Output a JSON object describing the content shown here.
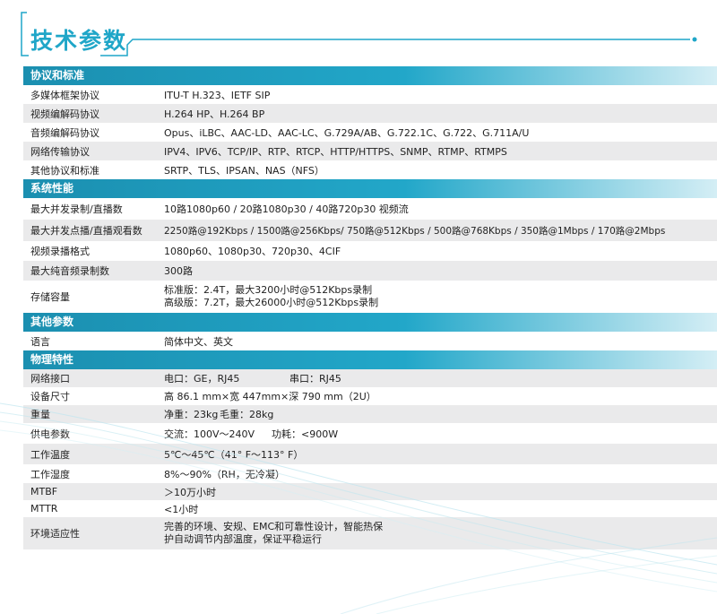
{
  "page": {
    "title": "技术参数"
  },
  "colors": {
    "accent": "#22a7c9",
    "row_alt": "#eaeaeb",
    "title": "#1fa6c8"
  },
  "sections": [
    {
      "title": "协议和标准",
      "rows": [
        {
          "label": "多媒体框架协议",
          "value": "ITU-T H.323、IETF SIP"
        },
        {
          "label": "视频编解码协议",
          "value": "H.264 HP、H.264 BP"
        },
        {
          "label": "音频编解码协议",
          "value": "Opus、iLBC、AAC-LD、AAC-LC、G.729A/AB、G.722.1C、G.722、G.711A/U"
        },
        {
          "label": "网络传输协议",
          "value": "IPV4、IPV6、TCP/IP、RTP、RTCP、HTTP/HTTPS、SNMP、RTMP、RTMPS"
        },
        {
          "label": "其他协议和标准",
          "value": "SRTP、TLS、IPSAN、NAS（NFS）"
        }
      ]
    },
    {
      "title": "系统性能",
      "rows": [
        {
          "label": "最大并发录制/直播数",
          "value": "10路1080p60 / 20路1080p30 / 40路720p30 视频流"
        },
        {
          "label": "最大并发点播/直播观看数",
          "value": "2250路@192Kbps / 1500路@256Kbps/ 750路@512Kbps / 500路@768Kbps / 350路@1Mbps / 170路@2Mbps"
        },
        {
          "label": "视频录播格式",
          "value": "1080p60、1080p30、720p30、4CIF"
        },
        {
          "label": "最大纯音频录制数",
          "value": "300路"
        },
        {
          "label": "存储容量",
          "value": "标准版：2.4T，最大3200小时@512Kbps录制",
          "value2": "高级版：7.2T，最大26000小时@512Kbps录制"
        }
      ]
    },
    {
      "title": "其他参数",
      "rows": [
        {
          "label": "语言",
          "value": "简体中文、英文"
        }
      ]
    },
    {
      "title": "物理特性",
      "rows": [
        {
          "label": "网络接口",
          "value": "电口：GE，RJ45",
          "extra": "串口：RJ45"
        },
        {
          "label": "设备尺寸",
          "value": "高 86.1 mm×宽 447mm×深 790 mm（2U）"
        },
        {
          "label": "重量",
          "value": "净重：23kg",
          "extra": "毛重：28kg"
        },
        {
          "label": "供电参数",
          "value": "交流：100V～240V",
          "extra": "功耗：<900W"
        },
        {
          "label": "工作温度",
          "value": "5℃～45℃（41° F～113° F）"
        },
        {
          "label": "工作湿度",
          "value": "8%～90%（RH，无冷凝）"
        },
        {
          "label": "MTBF",
          "value": "＞10万小时"
        },
        {
          "label": "MTTR",
          "value": "<1小时"
        },
        {
          "label": "环境适应性",
          "value": "完善的环境、安规、EMC和可靠性设计，智能热保",
          "value2": "护自动调节内部温度，保证平稳运行"
        }
      ]
    }
  ]
}
